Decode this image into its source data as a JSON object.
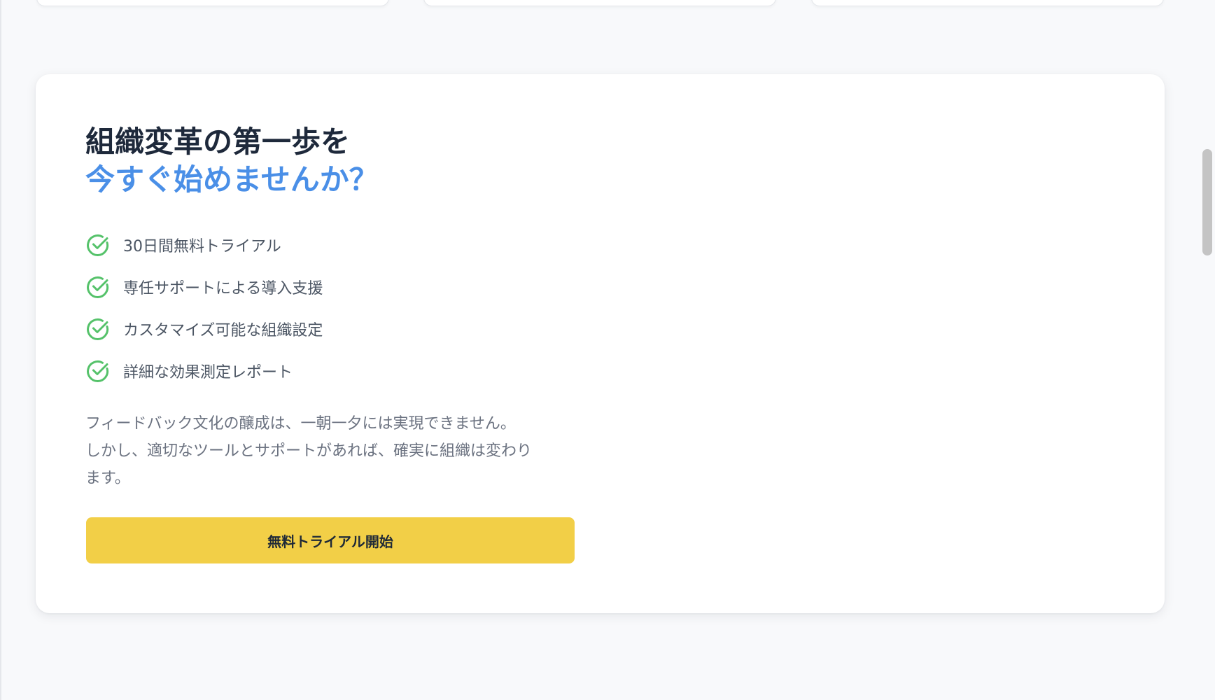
{
  "cta": {
    "title_line1": "組織変革の第一歩を",
    "title_line2": "今すぐ始めませんか？",
    "features": [
      {
        "label": "30日間無料トライアル",
        "icon": "check-circle-icon"
      },
      {
        "label": "専任サポートによる導入支援",
        "icon": "check-circle-icon"
      },
      {
        "label": "カスタマイズ可能な組織設定",
        "icon": "check-circle-icon"
      },
      {
        "label": "詳細な効果測定レポート",
        "icon": "check-circle-icon"
      }
    ],
    "description_line1": "フィードバック文化の醸成は、一朝一夕には実現できません。",
    "description_line2": "しかし、適切なツールとサポートがあれば、確実に組織は変わり",
    "description_line3": "ます。",
    "button_label": "無料トライアル開始"
  },
  "colors": {
    "accent_blue": "#4a8fe7",
    "check_green": "#55c26a",
    "button_yellow": "#f2cf47"
  }
}
